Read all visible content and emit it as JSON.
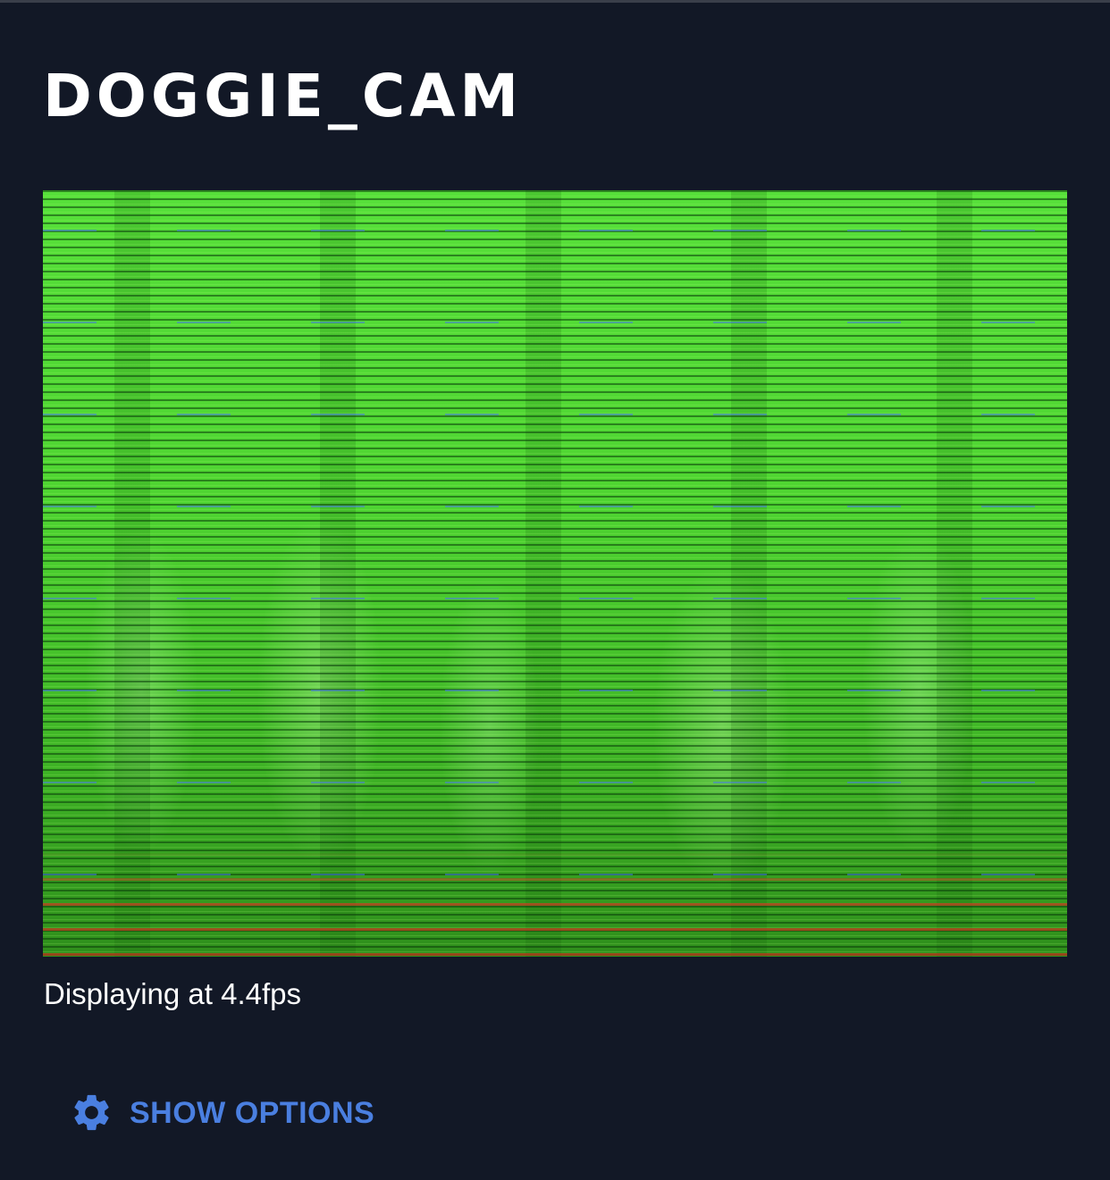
{
  "camera": {
    "title": "DOGGIE_CAM",
    "feed_icon": "camera-feed-image",
    "status_text": "Displaying at 4.4fps"
  },
  "options": {
    "label": "SHOW OPTIONS",
    "icon": "gear-icon"
  },
  "colors": {
    "background": "#121826",
    "title": "#ffffff",
    "accent": "#4a7fe0",
    "feed_green": "#45c82c"
  }
}
